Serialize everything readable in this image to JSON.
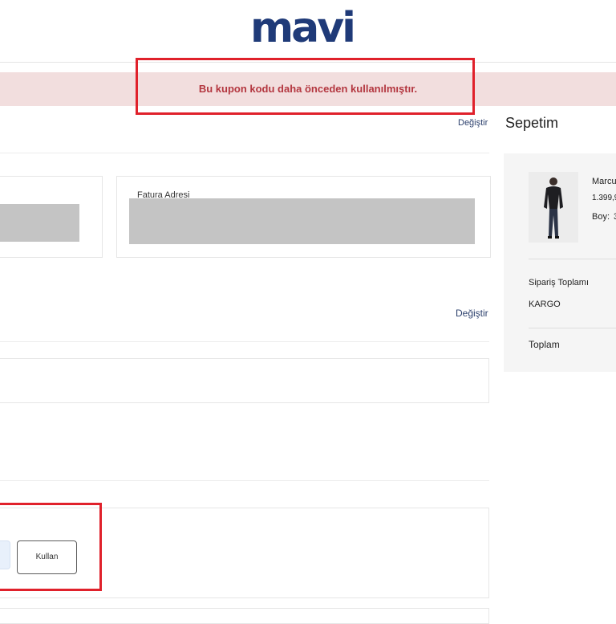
{
  "brand": {
    "logo_text": "mavi",
    "color": "#1f3a78"
  },
  "alert": {
    "message": "Bu kupon kodu daha önceden kullanılmıştır.",
    "bg": "#f2dede",
    "color": "#b3363f"
  },
  "address_section": {
    "change_label": "Değiştir",
    "billing_address_label": "Fatura Adresi"
  },
  "shipping_section": {
    "change_label": "Değiştir"
  },
  "coupon": {
    "apply_button": "Kullan"
  },
  "cart": {
    "title": "Sepetim",
    "item": {
      "name": "Marcu",
      "price": "1.399,9",
      "size_label": "Boy:",
      "size_value": "3"
    },
    "order_total_label": "Sipariş Toplamı",
    "shipping_label": "KARGO",
    "total_label": "Toplam"
  },
  "annotation_color": "#e0212b"
}
